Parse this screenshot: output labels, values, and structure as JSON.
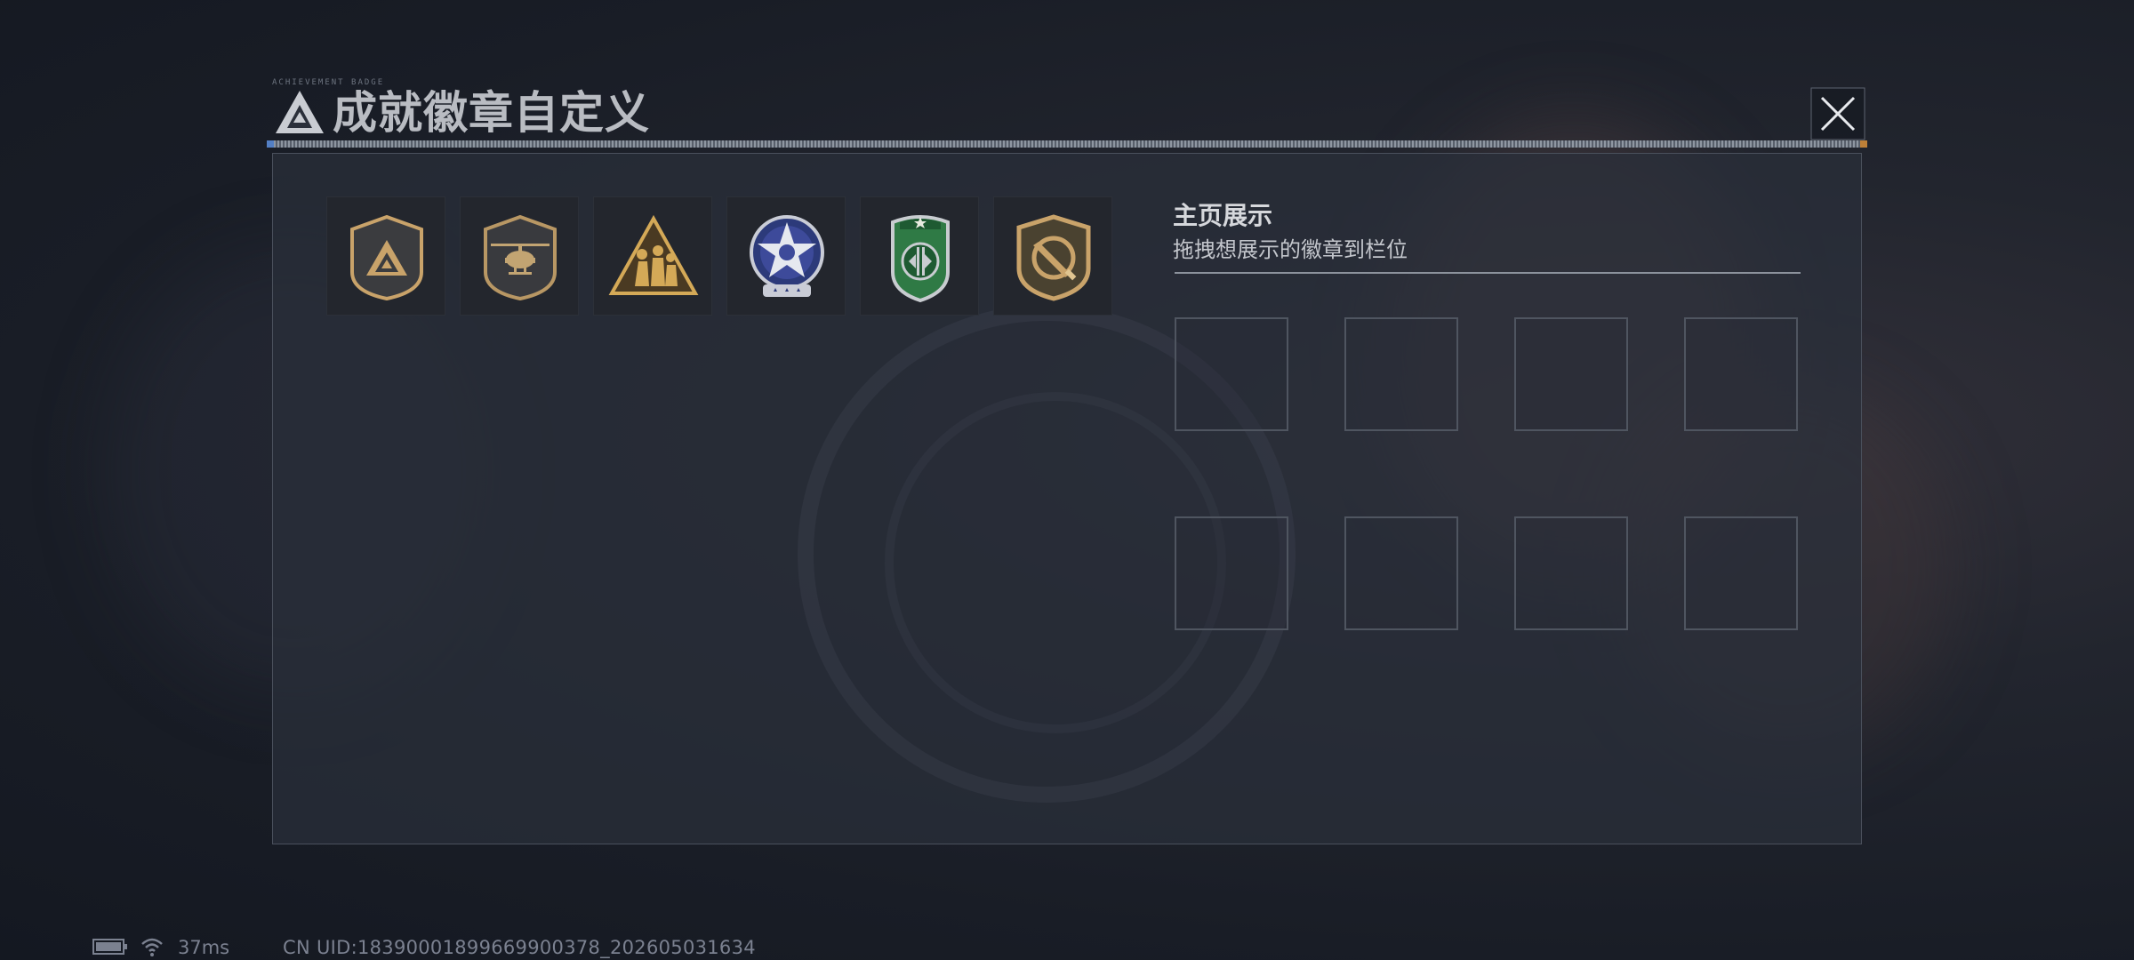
{
  "dialog": {
    "title": "成就徽章自定义",
    "micro_text": "ACHIEVEMENT BADGE"
  },
  "badges": [
    {
      "name": "triangle-shield-badge-icon",
      "color": "#c9a36a"
    },
    {
      "name": "helicopter-shield-badge-icon",
      "color": "#c9a36a"
    },
    {
      "name": "soldiers-triangle-badge-icon",
      "color": "#d4a957"
    },
    {
      "name": "star-round-badge-icon",
      "color": "#3d4a9a"
    },
    {
      "name": "green-shield-badge-icon",
      "color": "#2f7a45"
    },
    {
      "name": "knife-shield-badge-icon",
      "color": "#c9a36a"
    }
  ],
  "home_display": {
    "title": "主页展示",
    "subtitle": "拖拽想展示的徽章到栏位",
    "slots_count": 8
  },
  "status_bar": {
    "ping": "37ms",
    "uid": "CN UID:18390001899669900378_202605031634"
  },
  "colors": {
    "accent_blue": "#5a8ad6",
    "accent_orange": "#d08a3a"
  }
}
